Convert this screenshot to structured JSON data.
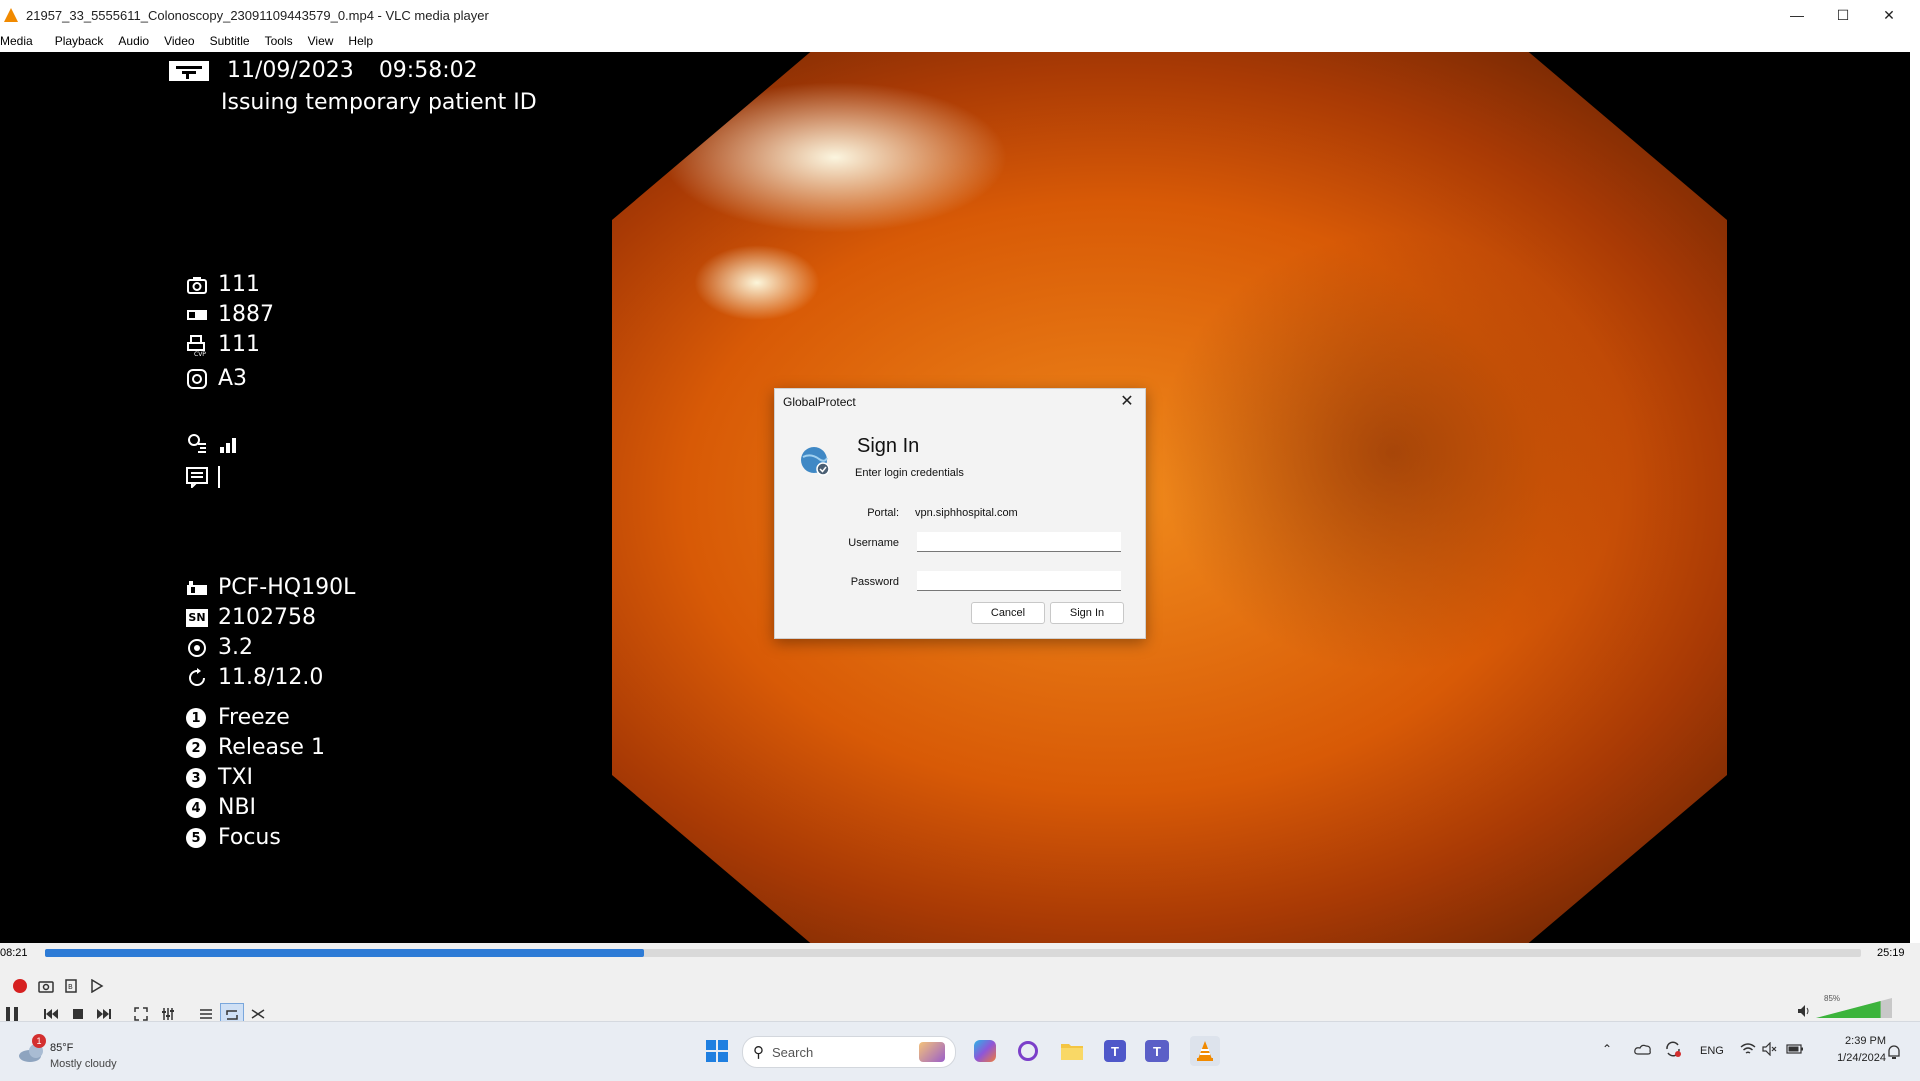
{
  "window": {
    "title": "21957_33_5555611_Colonoscopy_23091109443579_0.mp4 - VLC media player",
    "min_icon": "minimize-icon",
    "max_icon": "maximize-icon",
    "close_icon": "close-icon"
  },
  "menu": [
    "Media",
    "Playback",
    "Audio",
    "Video",
    "Subtitle",
    "Tools",
    "View",
    "Help"
  ],
  "osd": {
    "datetime_date": "11/09/2023",
    "datetime_time": "09:58:02",
    "patient_status": "Issuing temporary patient ID",
    "counter1": "111",
    "counter2": "1887",
    "counter3": "111",
    "mode": "A3",
    "scope_model": "PCF-HQ190L",
    "serial": "2102758",
    "value1": "3.2",
    "value2": "11.8/12.0",
    "buttons": [
      {
        "num": "1",
        "label": "Freeze"
      },
      {
        "num": "2",
        "label": "Release 1"
      },
      {
        "num": "3",
        "label": "TXI"
      },
      {
        "num": "4",
        "label": "NBI"
      },
      {
        "num": "5",
        "label": "Focus"
      }
    ]
  },
  "dialog": {
    "title": "GlobalProtect",
    "heading": "Sign In",
    "subheading": "Enter login credentials",
    "portal_label": "Portal:",
    "portal_value": "vpn.siphhospital.com",
    "username_label": "Username",
    "username_value": "",
    "password_label": "Password",
    "password_value": "",
    "cancel_label": "Cancel",
    "signin_label": "Sign In"
  },
  "player": {
    "elapsed": "08:21",
    "total": "25:19",
    "progress_fraction": 0.33,
    "volume_percent": "85%",
    "volume_fraction": 0.85
  },
  "taskbar": {
    "weather_temp": "85°F",
    "weather_desc": "Mostly cloudy",
    "weather_badge": "1",
    "search_placeholder": "Search",
    "lang": "ENG",
    "clock_time": "2:39 PM",
    "clock_date": "1/24/2024"
  },
  "colors": {
    "accent": "#2d7bd6",
    "vlc_orange": "#f18a00"
  }
}
